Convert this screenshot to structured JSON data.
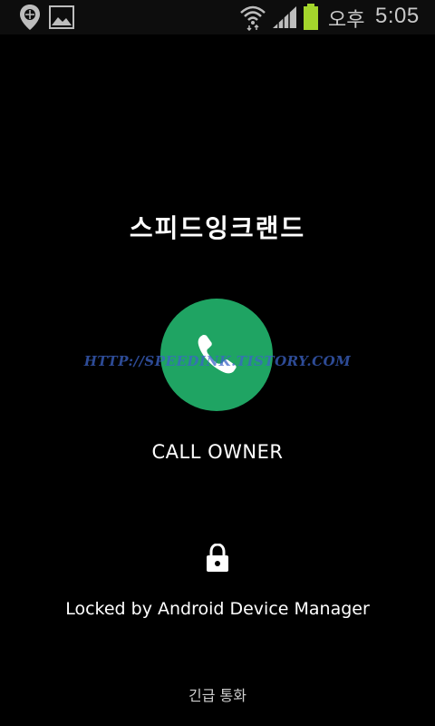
{
  "status_bar": {
    "icons_left": [
      "location-icon",
      "image-icon"
    ],
    "icons_right": [
      "wifi-icon",
      "signal-icon",
      "battery-icon"
    ],
    "ampm": "오후",
    "time": "5:05",
    "battery_color": "#a4d62c"
  },
  "lock_screen": {
    "owner_name": "스피드잉크랜드",
    "call_button_color": "#1fa463",
    "call_label": "CALL OWNER",
    "watermark": "HTTP://SPEEDINK.TISTORY.COM",
    "locked_message": "Locked by Android Device Manager",
    "emergency_call": "긴급 통화"
  }
}
